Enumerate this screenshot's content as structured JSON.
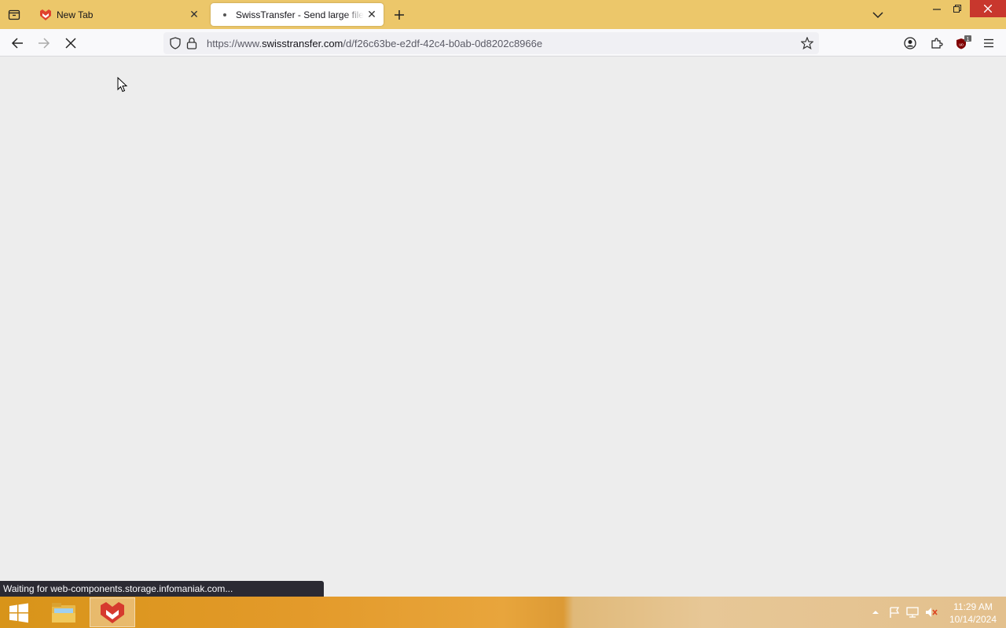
{
  "tabs": [
    {
      "title": "New Tab",
      "active": false
    },
    {
      "title": "SwissTransfer - Send large files",
      "active": true
    }
  ],
  "url": {
    "prefix": "https://www.",
    "host": "swisstransfer.com",
    "path": "/d/f26c63be-e2df-42c4-b0ab-0d8202c8966e"
  },
  "extensions": {
    "ublock_badge": "1"
  },
  "status": "Waiting for web-components.storage.infomaniak.com...",
  "clock": {
    "time": "11:29 AM",
    "date": "10/14/2024"
  },
  "colors": {
    "tabstrip": "#ecc76a",
    "page_background": "#ededed",
    "close_hover": "#c8372d"
  }
}
